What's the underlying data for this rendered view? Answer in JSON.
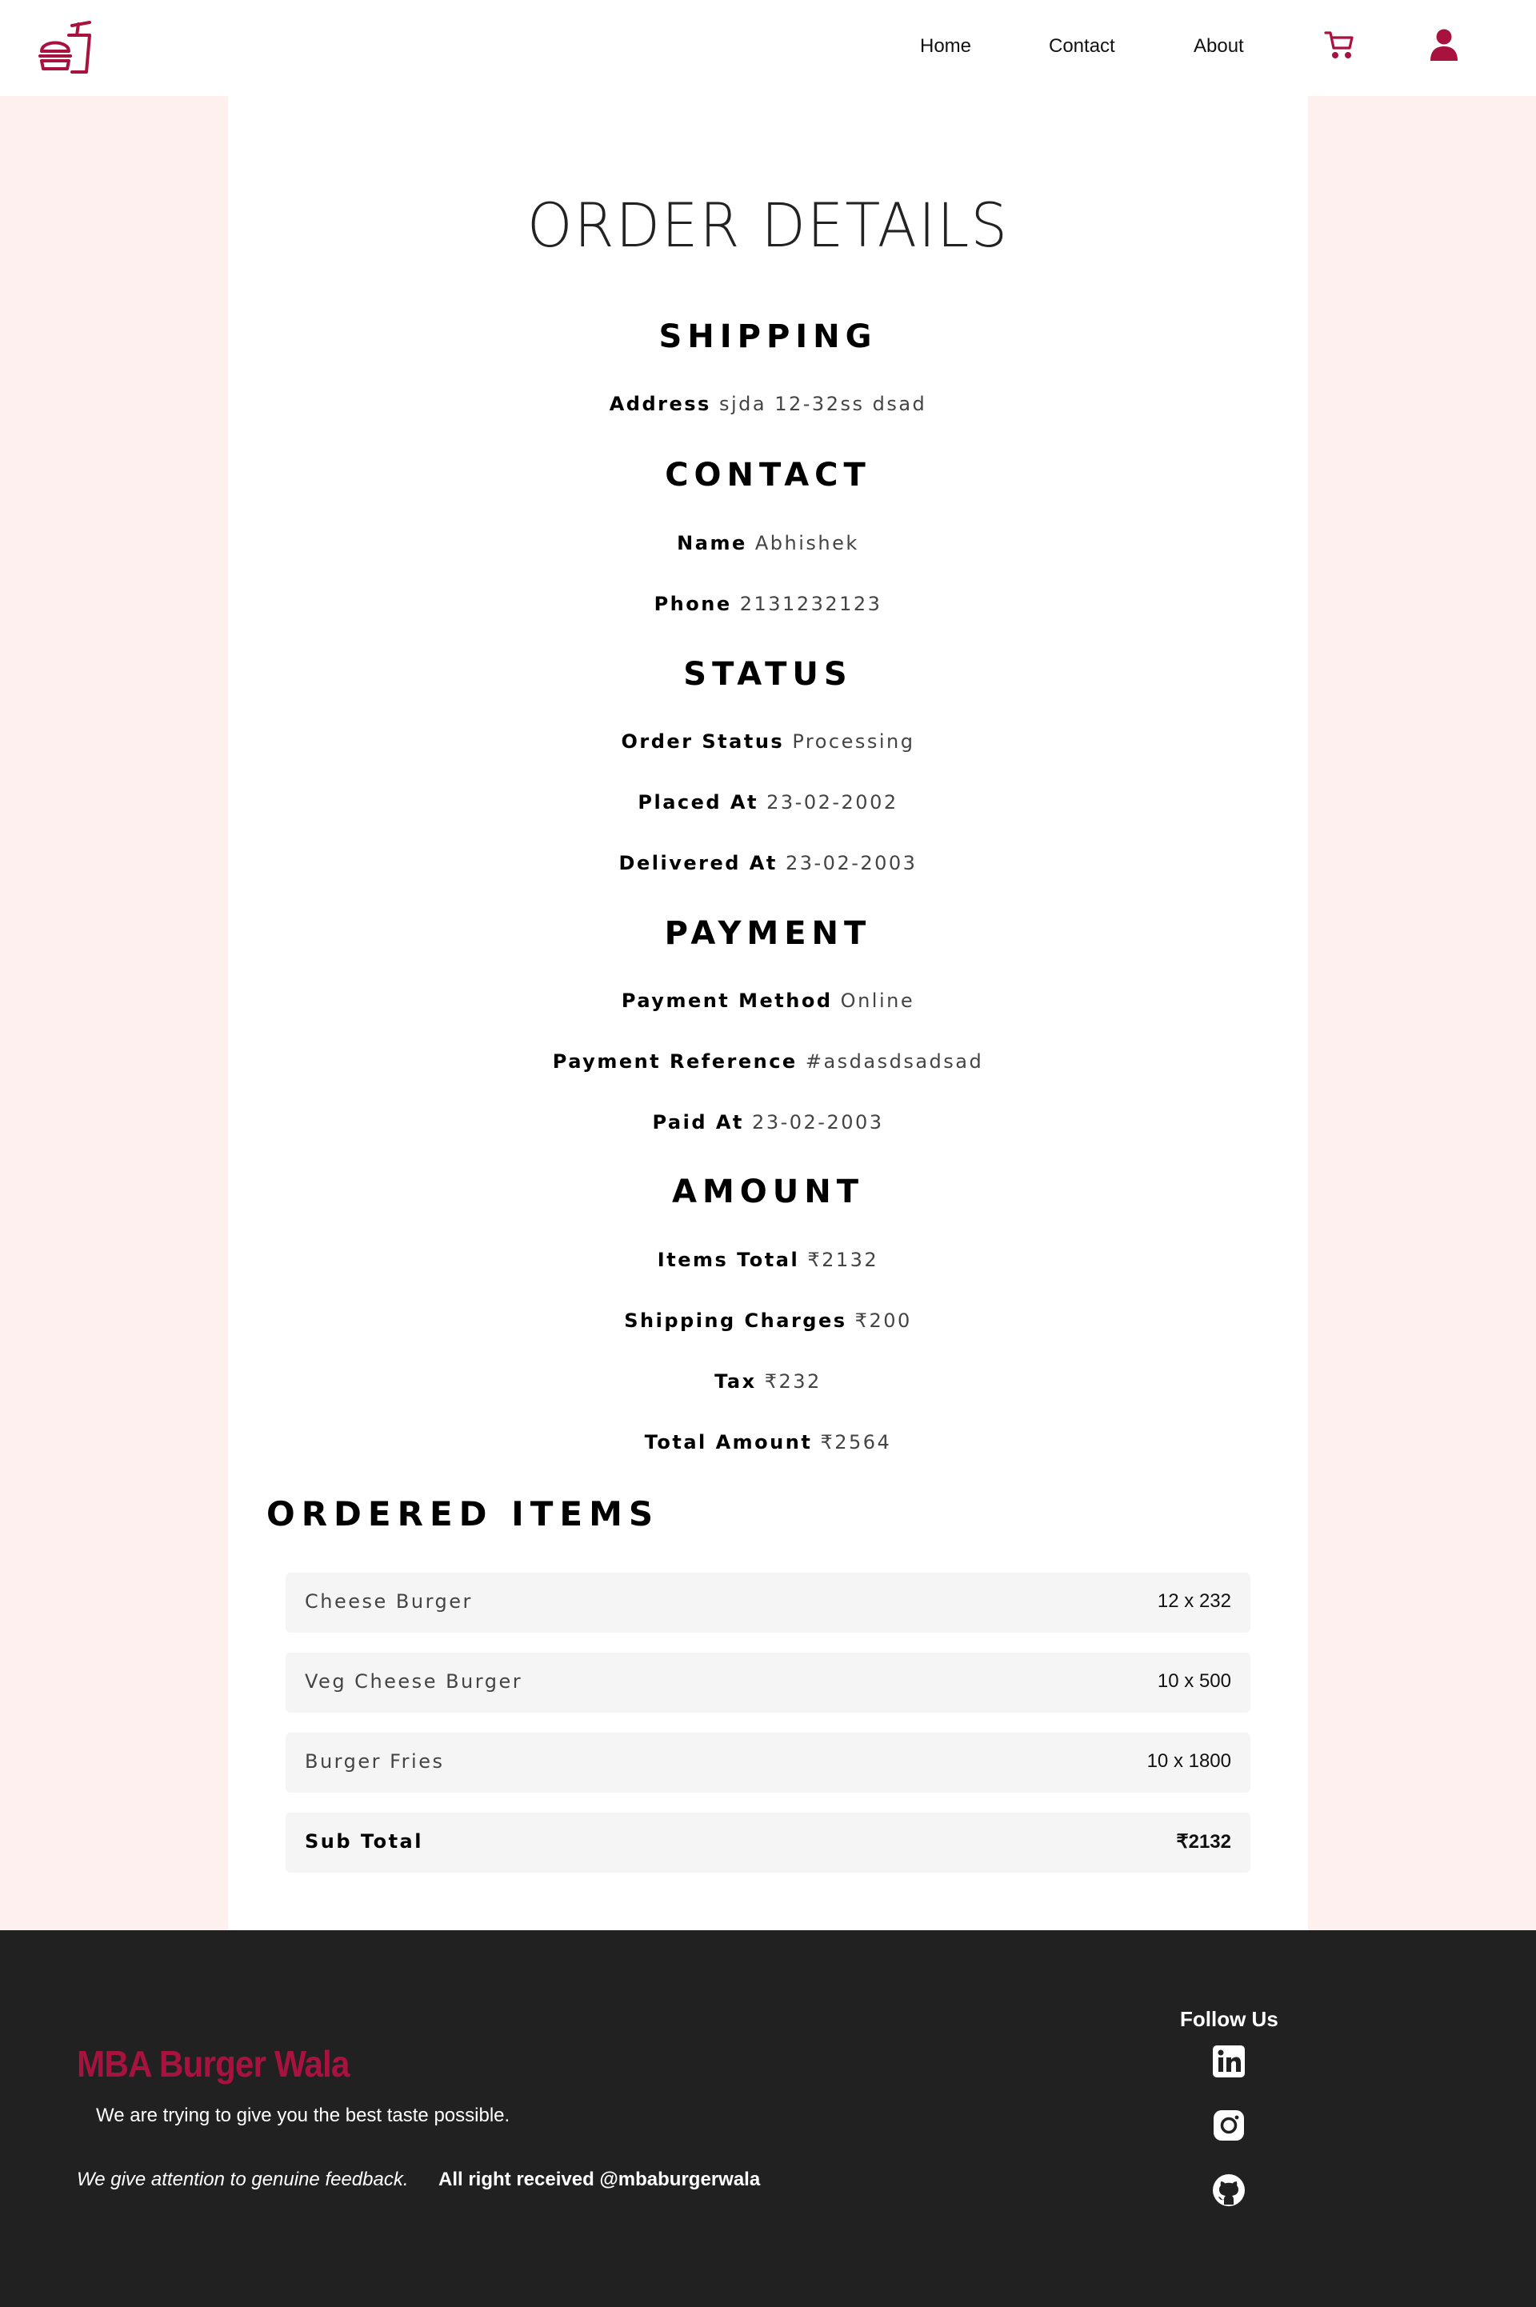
{
  "header": {
    "nav": {
      "home": "Home",
      "contact": "Contact",
      "about": "About"
    },
    "accent_color": "#a8123e"
  },
  "page_title": "ORDER DETAILS",
  "shipping": {
    "title": "SHIPPING",
    "address_label": "Address",
    "address_value": "sjda 12-32ss dsad"
  },
  "contact": {
    "title": "CONTACT",
    "name_label": "Name",
    "name_value": "Abhishek",
    "phone_label": "Phone",
    "phone_value": "2131232123"
  },
  "status": {
    "title": "STATUS",
    "order_status_label": "Order Status",
    "order_status_value": "Processing",
    "placed_label": "Placed At",
    "placed_value": "23-02-2002",
    "delivered_label": "Delivered At",
    "delivered_value": "23-02-2003"
  },
  "payment": {
    "title": "PAYMENT",
    "method_label": "Payment Method",
    "method_value": "Online",
    "reference_label": "Payment Reference",
    "reference_value": "#asdasdsadsad",
    "paid_label": "Paid At",
    "paid_value": "23-02-2003"
  },
  "amount": {
    "title": "AMOUNT",
    "items_total_label": "Items Total",
    "items_total_value": "₹2132",
    "shipping_label": "Shipping Charges",
    "shipping_value": "₹200",
    "tax_label": "Tax",
    "tax_value": "₹232",
    "total_label": "Total Amount",
    "total_value": "₹2564"
  },
  "ordered_items": {
    "title": "ORDERED ITEMS",
    "items": [
      {
        "name": "Cheese Burger",
        "qty": "12 x 232"
      },
      {
        "name": "Veg Cheese Burger",
        "qty": "10 x 500"
      },
      {
        "name": "Burger Fries",
        "qty": "10 x 1800"
      }
    ],
    "subtotal_label": "Sub Total",
    "subtotal_value": "₹2132"
  },
  "footer": {
    "brand": "MBA Burger Wala",
    "tagline": "We are trying to give you the best taste possible.",
    "feedback": "We give attention to genuine feedback.",
    "rights": "All right received @mbaburgerwala",
    "follow": "Follow Us",
    "social_icons": [
      "linkedin-icon",
      "instagram-icon",
      "github-icon"
    ]
  }
}
